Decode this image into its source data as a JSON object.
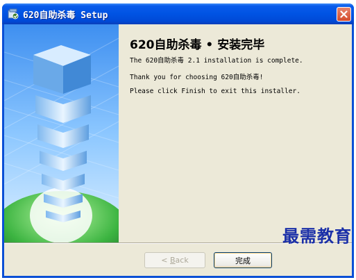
{
  "window": {
    "title": "620自助杀毒 Setup",
    "app_icon": "installer-icon",
    "close_icon": "close-icon"
  },
  "content": {
    "heading": "620自助杀毒 • 安装完毕",
    "line1": "The 620自助杀毒 2.1 installation is complete.",
    "line2": "Thank you for choosing 620自助杀毒!",
    "line3": "Please click Finish to exit this installer."
  },
  "buttons": {
    "back_prefix": "< ",
    "back_accel": "B",
    "back_rest": "ack",
    "finish": "完成"
  },
  "watermark": "最需教育",
  "colors": {
    "title_bar": "#0053e3",
    "dialog_bg": "#ece9d8",
    "watermark": "#1a2fa8"
  }
}
